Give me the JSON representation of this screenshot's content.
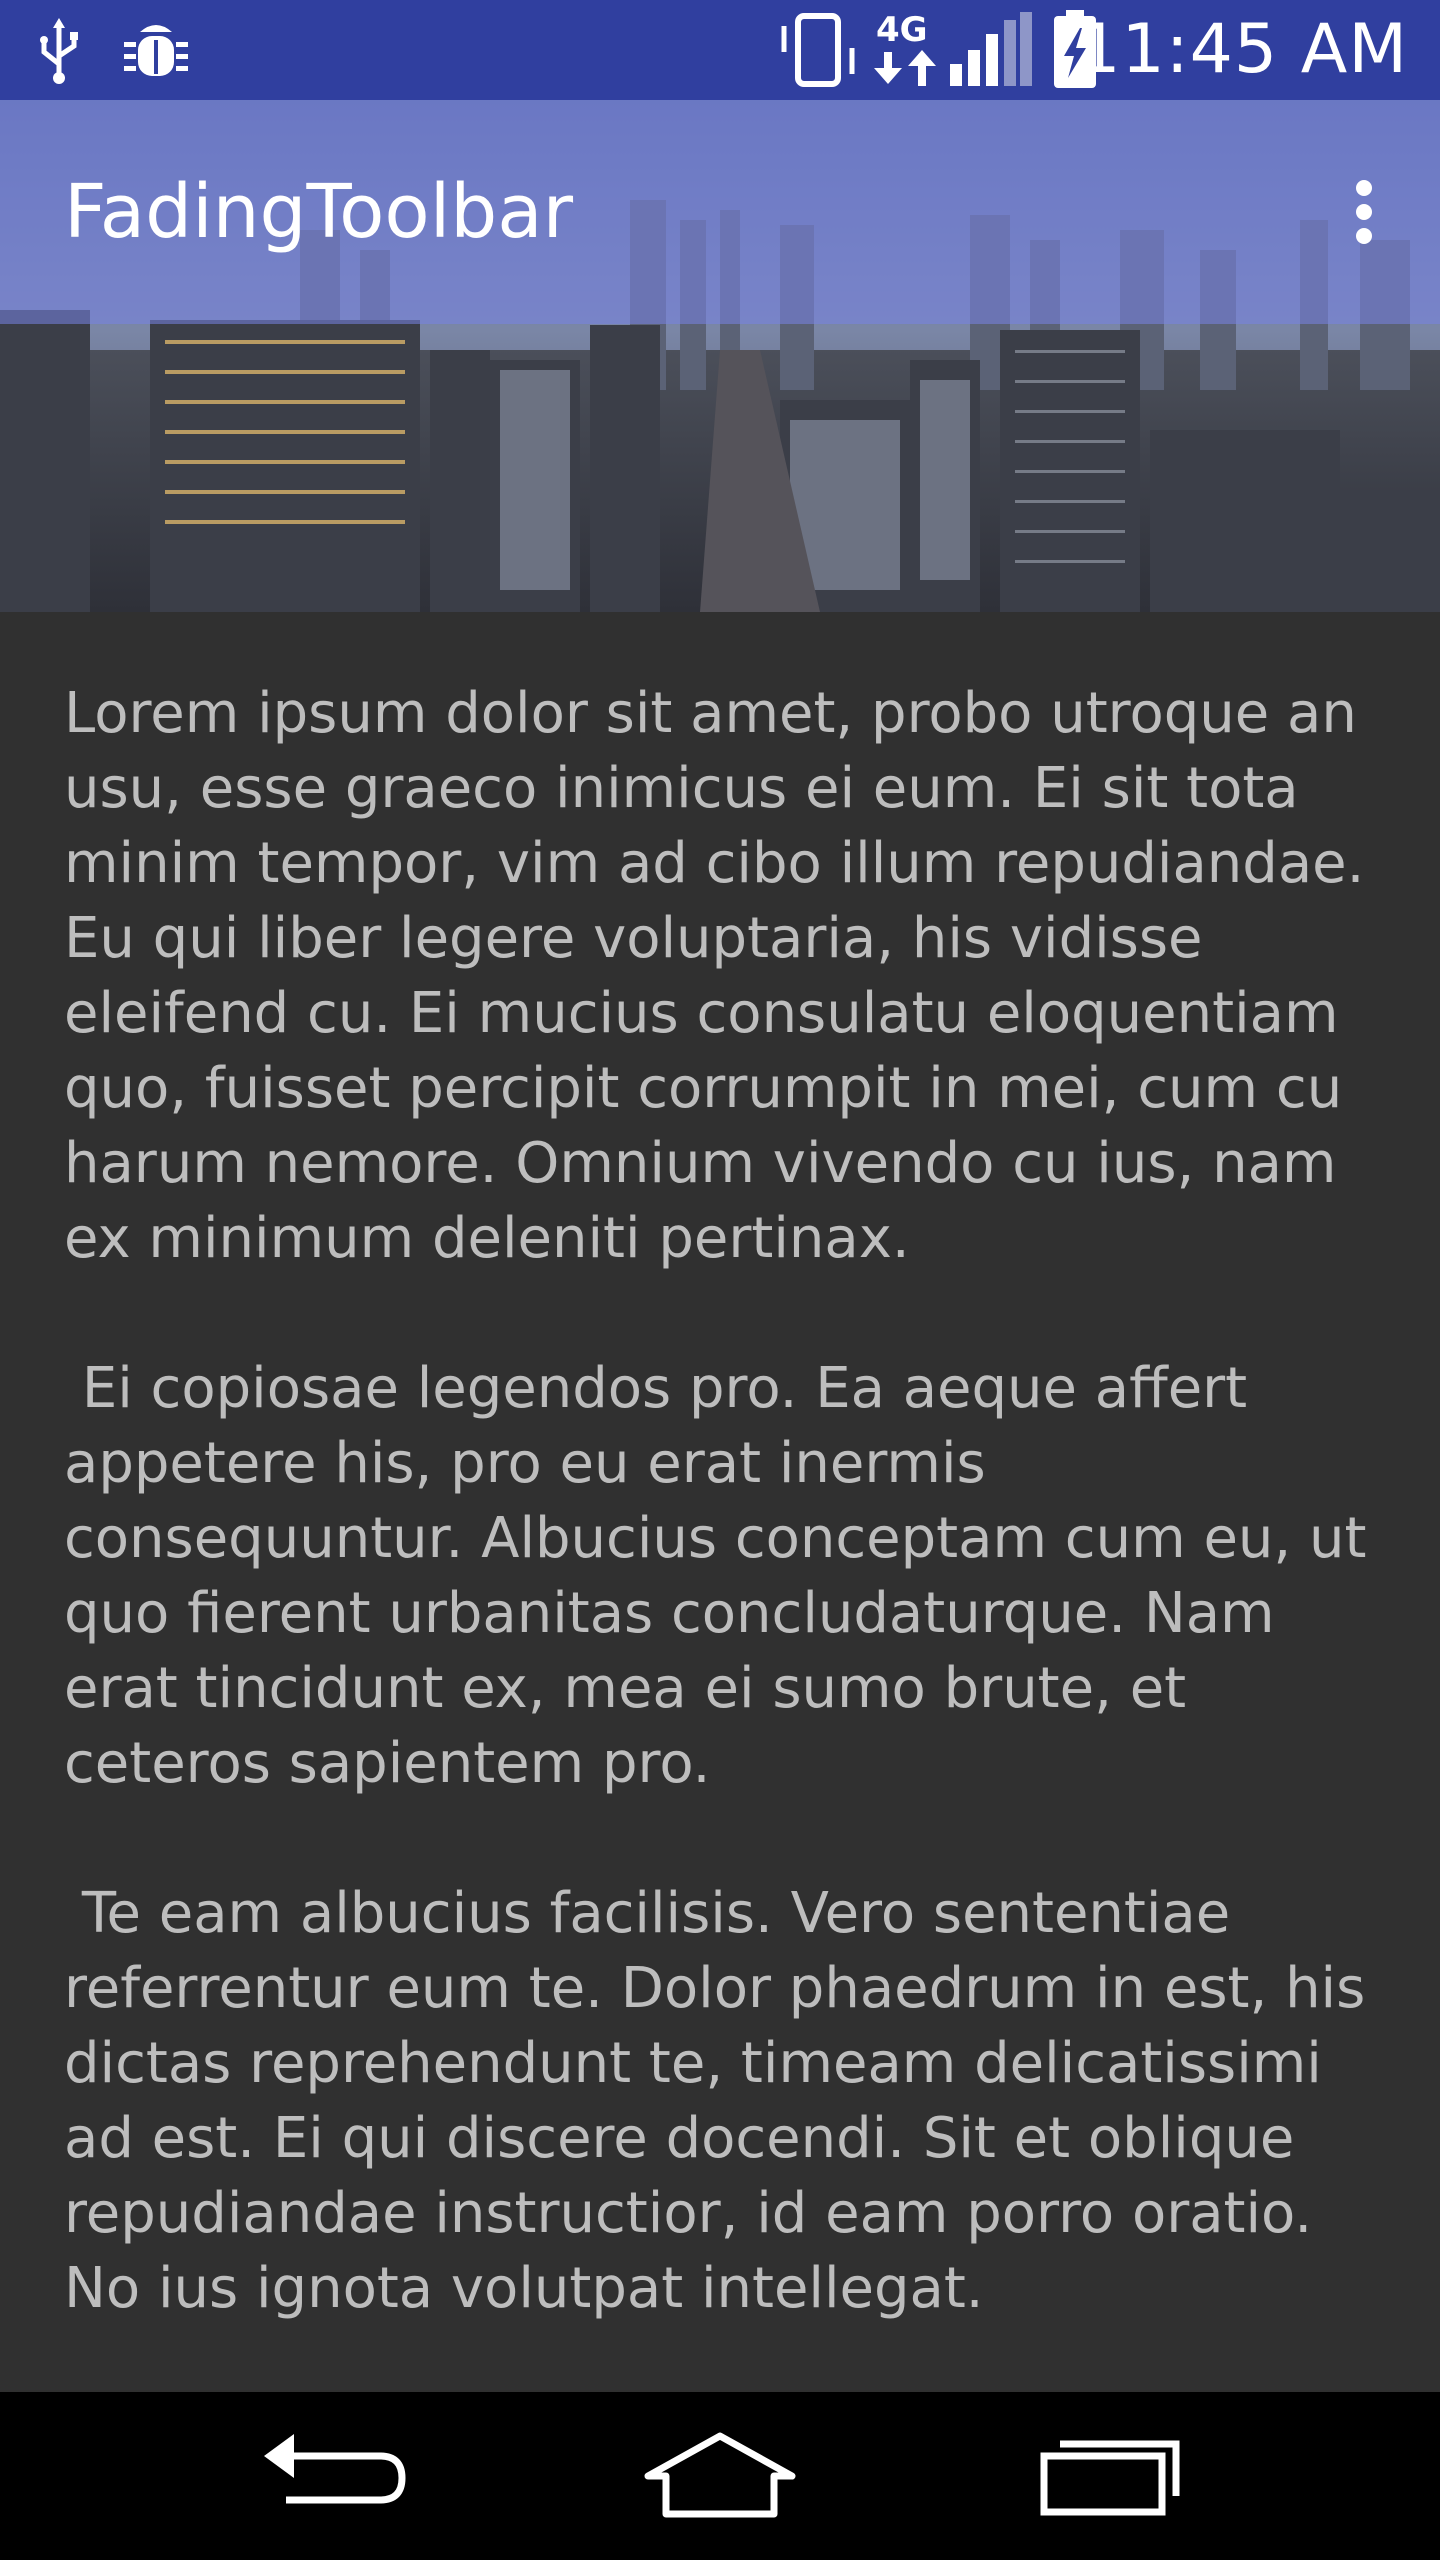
{
  "status_bar": {
    "time": "11:45 AM",
    "network": "4G",
    "left_icons": [
      "usb-icon",
      "bug-icon"
    ],
    "right_icons": [
      "vibrate-icon",
      "data-arrows-icon",
      "signal-icon",
      "battery-charging-icon"
    ],
    "background": "#303F9F"
  },
  "toolbar": {
    "title": "FadingToolbar",
    "overflow_icon": "more-vert-icon",
    "color": "#7884E6"
  },
  "content": {
    "paragraphs": [
      "Lorem ipsum dolor sit amet, probo utroque an usu, esse graeco inimicus ei eum. Ei sit tota minim tempor, vim ad cibo illum repudiandae. Eu qui liber legere voluptaria, his vidisse eleifend cu. Ei mucius consulatu eloquentiam quo, fuisset percipit corrumpit in mei, cum cu harum nemore. Omnium vivendo cu ius, nam ex minimum deleniti pertinax.",
      " Ei copiosae legendos pro. Ea aeque affert appetere his, pro eu erat inermis consequuntur. Albucius conceptam cum eu, ut quo fierent urbanitas concludaturque. Nam erat tincidunt ex, mea ei sumo brute, et ceteros sapientem pro.",
      " Te eam albucius facilisis. Vero sententiae referrentur eum te. Dolor phaedrum in est, his dictas reprehendunt te, timeam delicatissimi ad est. Ei qui discere docendi. Sit et oblique repudiandae instructior, id eam porro oratio. No ius ignota volutpat intellegat."
    ],
    "text_color": "#BDBDBD",
    "background": "#303030"
  },
  "nav_bar": {
    "buttons": [
      "back-icon",
      "home-icon",
      "recents-icon"
    ]
  }
}
